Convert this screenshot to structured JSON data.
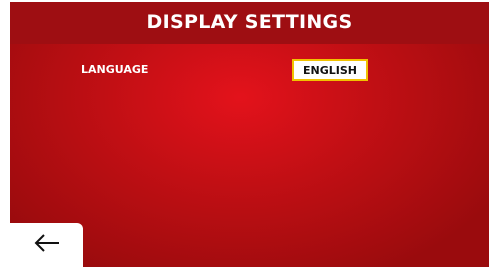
{
  "screen": {
    "title": "DISPLAY SETTINGS"
  },
  "settings": {
    "language_label": "LANGUAGE",
    "language_value": "ENGLISH"
  },
  "nav": {
    "back_icon": "arrow-left-icon"
  },
  "colors": {
    "background": "#c10f14",
    "title_bar": "#9e0e12",
    "button_border": "#f2c200",
    "text": "#ffffff"
  }
}
